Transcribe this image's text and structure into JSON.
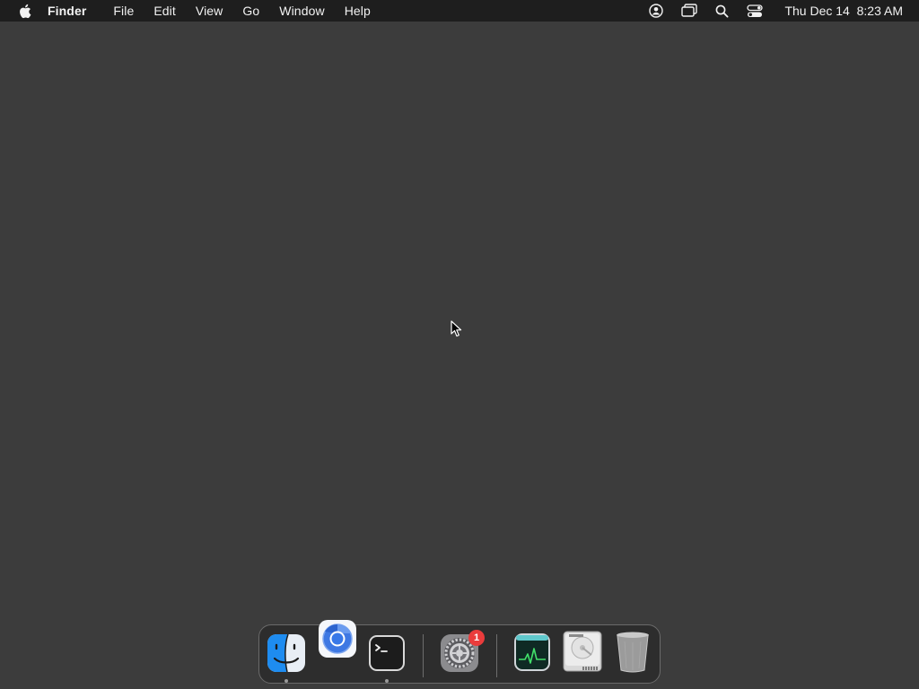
{
  "menubar": {
    "apple_icon": "apple-logo-icon",
    "app_name": "Finder",
    "menus": [
      "File",
      "Edit",
      "View",
      "Go",
      "Window",
      "Help"
    ],
    "status_icons": [
      "user-icon",
      "screen-mirroring-icon",
      "search-icon",
      "control-center-icon"
    ],
    "clock": "Thu Dec 14  8:23 AM"
  },
  "dock": {
    "apps": [
      {
        "name": "Finder",
        "icon": "finder-icon",
        "running": true
      },
      {
        "name": "Chromium",
        "icon": "chromium-icon",
        "running": false
      },
      {
        "name": "Terminal",
        "icon": "terminal-icon",
        "running": true
      },
      {
        "name": "System Settings",
        "icon": "settings-gear-icon",
        "running": false,
        "badge": "1"
      },
      {
        "name": "Activity Monitor",
        "icon": "activity-monitor-icon",
        "running": false
      },
      {
        "name": "Disk Utility",
        "icon": "disk-icon",
        "running": false
      },
      {
        "name": "Trash",
        "icon": "trash-icon",
        "running": false
      }
    ]
  },
  "colors": {
    "desktop": "#3c3c3c",
    "menubar": "#1e1e1e",
    "dock": "#2d2d2d",
    "badge": "#ea3c3c"
  }
}
